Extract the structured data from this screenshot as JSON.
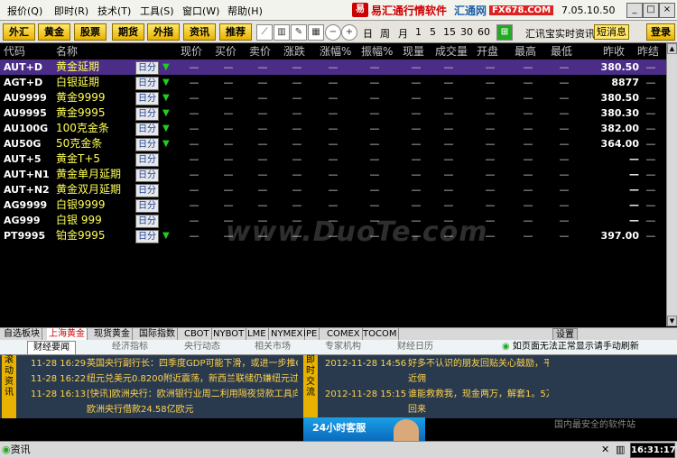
{
  "menu": [
    "报价(Q)",
    "即时(R)",
    "技术(T)",
    "工具(S)",
    "窗口(W)",
    "帮助(H)"
  ],
  "brand": {
    "logo": "易",
    "name": "易汇通行情软件",
    "network": "汇通网",
    "site": "FX678.COM",
    "version": "7.05.10.50"
  },
  "window_buttons": [
    "_",
    "□",
    "×"
  ],
  "toolbar": {
    "buttons": [
      "外汇",
      "黄金",
      "股票",
      "期货",
      "外指",
      "资讯",
      "推荐"
    ],
    "periods": [
      "日",
      "周",
      "月",
      "1",
      "5",
      "15",
      "30",
      "60"
    ],
    "info_text": "汇讯宝实时资讯",
    "msg_text": "短消息",
    "login": "登录"
  },
  "columns": [
    "代码",
    "名称",
    "现价",
    "买价",
    "卖价",
    "涨跌",
    "涨幅%",
    "振幅%",
    "现量",
    "成交量",
    "开盘",
    "最高",
    "最低",
    "昨收",
    "昨结"
  ],
  "rows": [
    {
      "code": "AUT+D",
      "name": "黄金延期",
      "badge": "日分",
      "trend": "down",
      "prev": "380.50",
      "selected": true
    },
    {
      "code": "AGT+D",
      "name": "白银延期",
      "badge": "日分",
      "trend": "down",
      "prev": "8877",
      "selected": false
    },
    {
      "code": "AU9999",
      "name": "黄金9999",
      "badge": "日分",
      "trend": "down",
      "prev": "380.50",
      "selected": false
    },
    {
      "code": "AU9995",
      "name": "黄金9995",
      "badge": "日分",
      "trend": "down",
      "prev": "380.30",
      "selected": false
    },
    {
      "code": "AU100G",
      "name": "100克金条",
      "badge": "日分",
      "trend": "down",
      "prev": "382.00",
      "selected": false
    },
    {
      "code": "AU50G",
      "name": "50克金条",
      "badge": "日分",
      "trend": "down",
      "prev": "364.00",
      "selected": false
    },
    {
      "code": "AUT+5",
      "name": "黄金T+5",
      "badge": "日分",
      "trend": "",
      "prev": "—",
      "selected": false
    },
    {
      "code": "AUT+N1",
      "name": "黄金单月延期",
      "badge": "日分",
      "trend": "",
      "prev": "—",
      "selected": false
    },
    {
      "code": "AUT+N2",
      "name": "黄金双月延期",
      "badge": "日分",
      "trend": "",
      "prev": "—",
      "selected": false
    },
    {
      "code": "AG9999",
      "name": "白银9999",
      "badge": "日分",
      "trend": "",
      "prev": "—",
      "selected": false
    },
    {
      "code": "AG999",
      "name": "白银 999",
      "badge": "日分",
      "trend": "",
      "prev": "—",
      "selected": false
    },
    {
      "code": "PT9995",
      "name": "铂金9995",
      "badge": "日分",
      "trend": "down",
      "prev": "397.00",
      "selected": false
    }
  ],
  "dash": "—",
  "watermark": "www.DuoTe.com",
  "market_tabs": [
    "自选板块",
    "上海黄金",
    "现货黄金",
    "国际指数",
    "CBOT",
    "NYBOT",
    "LME",
    "NYMEX",
    "IPE",
    "COMEX",
    "TOCOM"
  ],
  "market_tab_settings": "设置",
  "news_tabs": [
    "财经要闻",
    "经济指标",
    "央行动态",
    "相关市场",
    "专家机构",
    "财经日历"
  ],
  "news_notice": "如页面无法正常显示请手动刷新",
  "left_vlabel": "滚动资讯",
  "right_vlabel": "即时交流",
  "left_news": [
    {
      "time": "11-28 16:29",
      "text": "英国央行副行长：四季度GDP可能下滑，或进一步推QE"
    },
    {
      "time": "11-28 16:22",
      "text": "纽元兑美元0.8200附近震荡，新西兰联储仍嫌纽元过高"
    },
    {
      "time": "11-28 16:13",
      "text": "[快讯]欧洲央行：欧洲银行业周二利用隔夜贷款工具向"
    },
    {
      "time": "",
      "text": "欧洲央行借款24.58亿欧元"
    }
  ],
  "right_news": [
    {
      "time": "2012-11-28 14:56",
      "text": "好多不认识的朋友回贴关心鼓励，平台"
    },
    {
      "time": "",
      "text": "近佣"
    },
    {
      "time": "2012-11-28 15:15",
      "text": "谁能救救我，现金两万，解套1。5万美"
    },
    {
      "time": "",
      "text": "回来"
    }
  ],
  "ad": {
    "title": "24小时客服"
  },
  "bottom_logo": "国内最安全的软件站",
  "status": {
    "label": "资讯",
    "time": "16:31:17"
  },
  "colors": {
    "selected_row": "#4b2d88",
    "name_yellow": "#ffff5a",
    "news_gold": "#ffd24a"
  }
}
